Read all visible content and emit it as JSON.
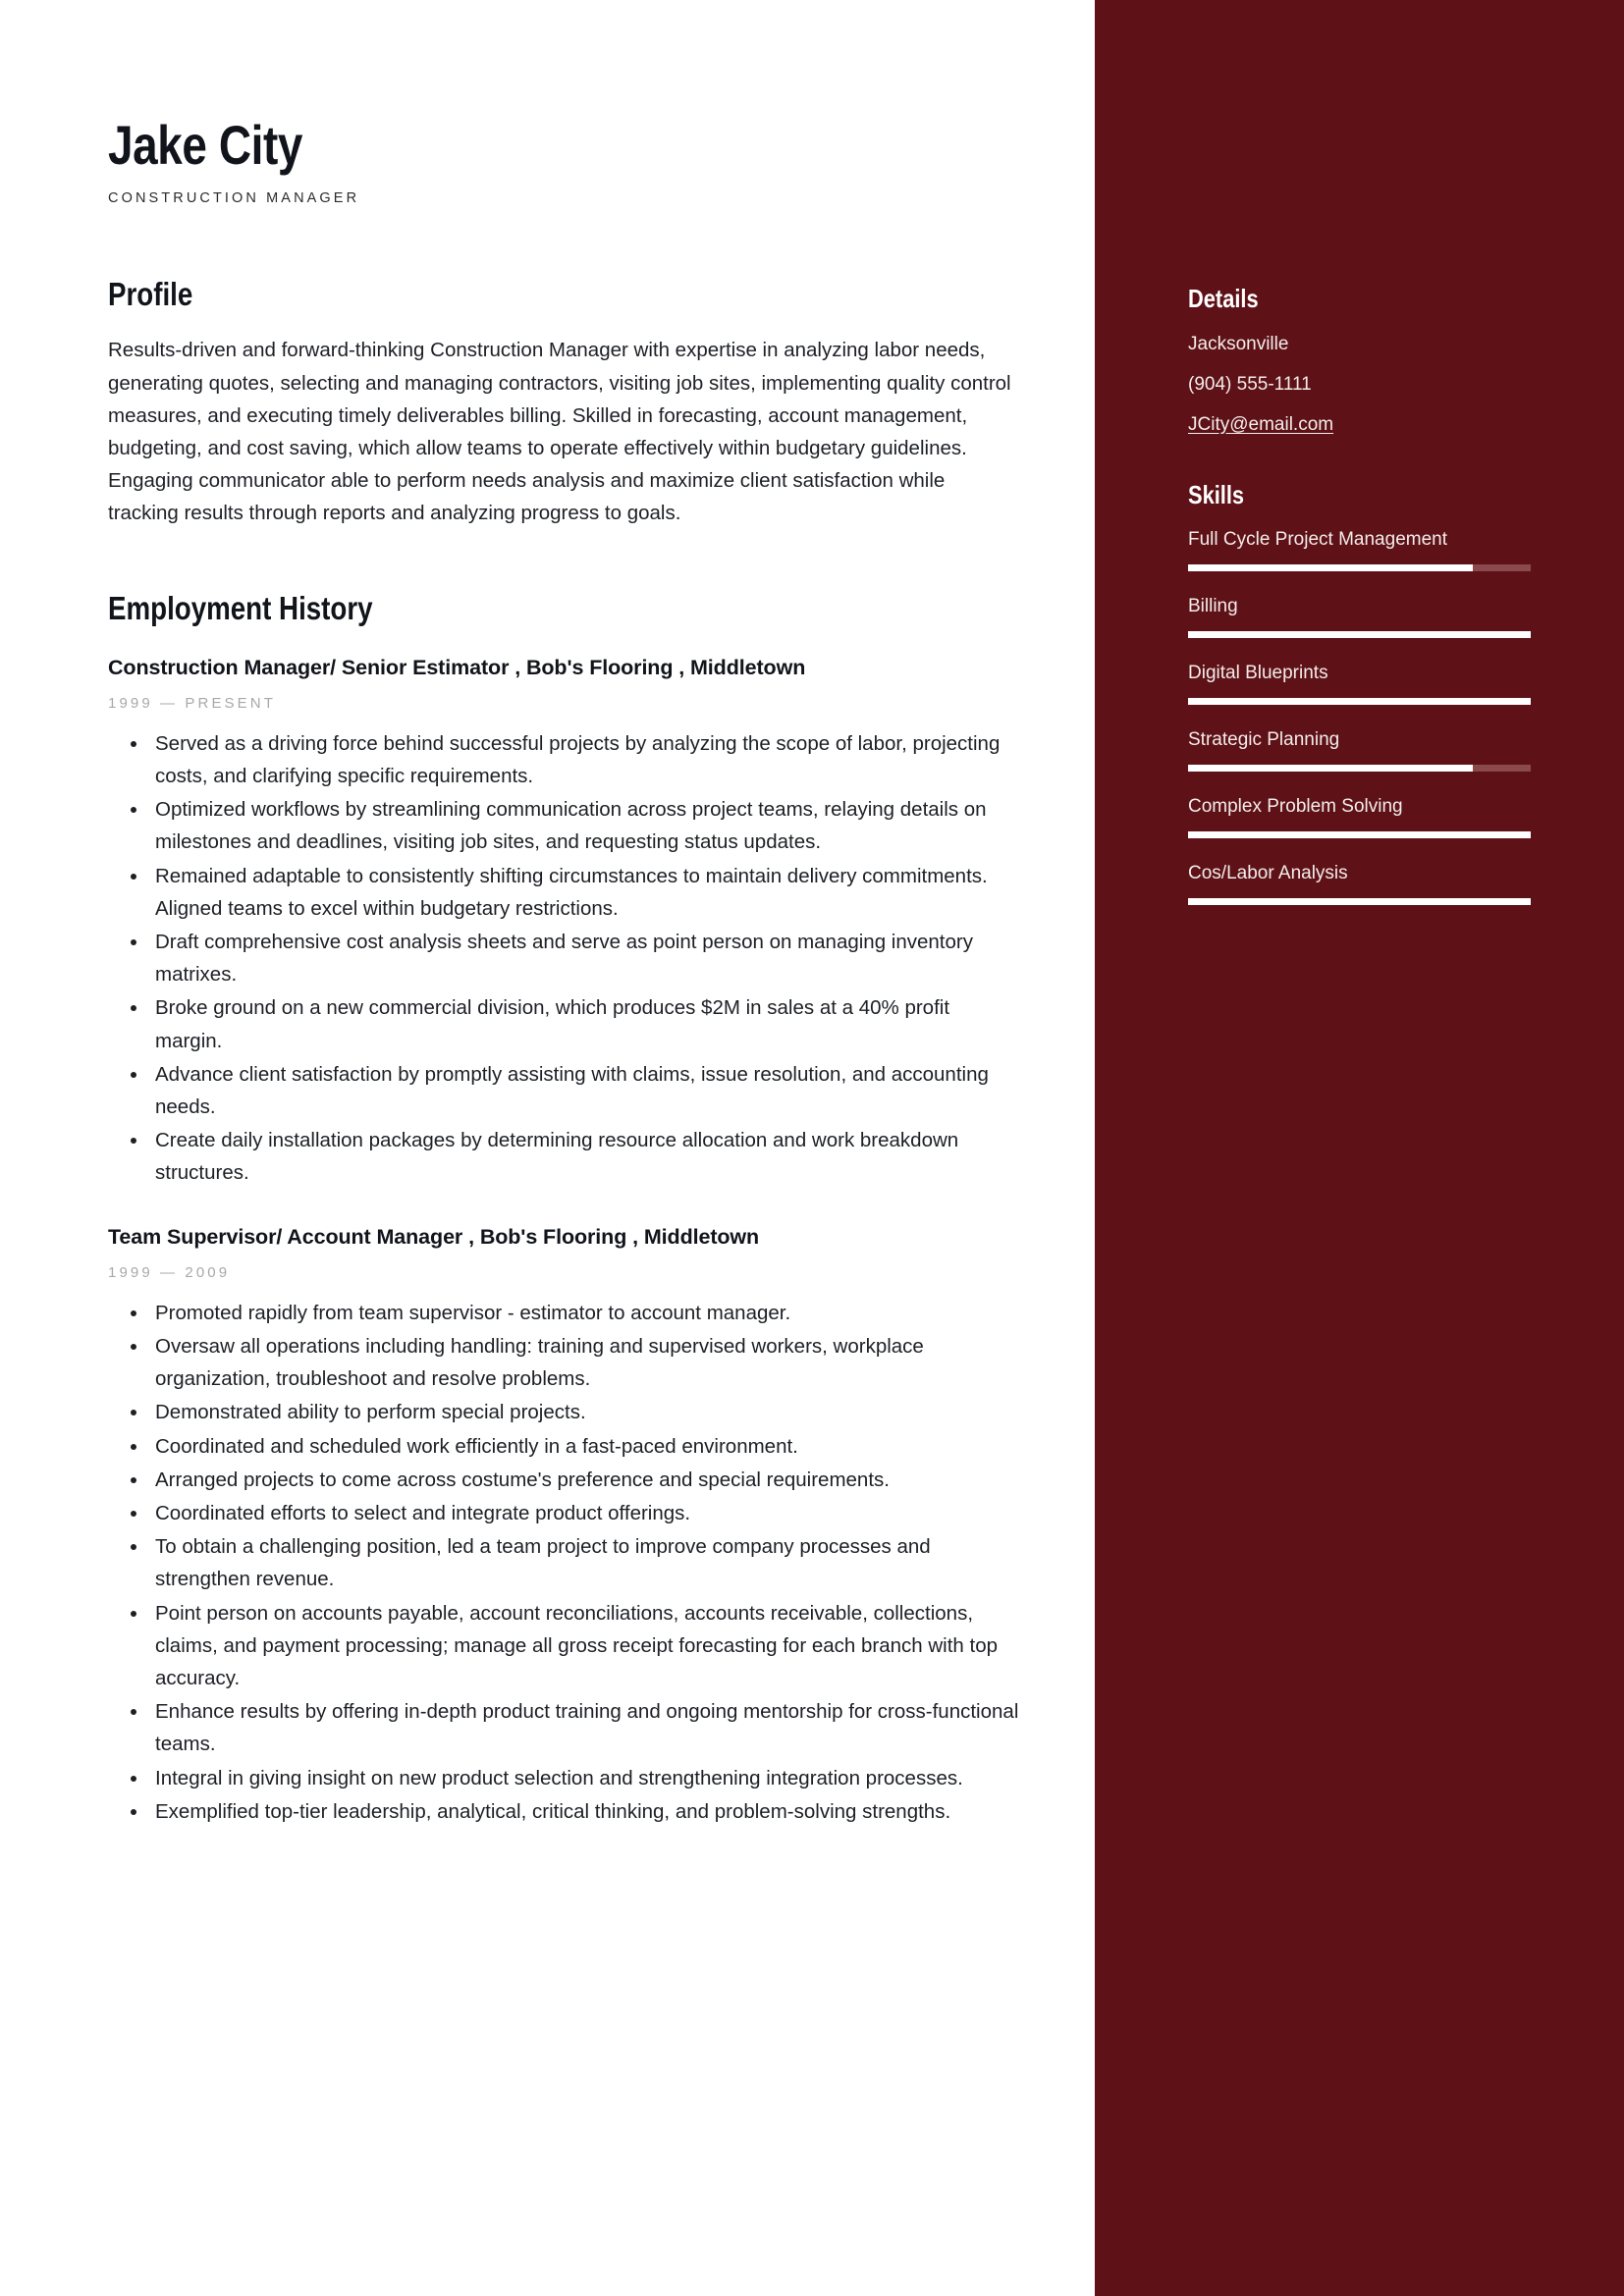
{
  "header": {
    "name": "Jake City",
    "subtitle": "CONSTRUCTION MANAGER"
  },
  "profile": {
    "heading": "Profile",
    "text": "Results-driven and forward-thinking Construction Manager with expertise in analyzing labor needs, generating quotes, selecting and managing contractors, visiting job sites, implementing quality control measures, and executing timely deliverables billing. Skilled in forecasting, account management, budgeting, and cost saving, which allow teams to operate effectively within budgetary guidelines. Engaging communicator able to perform needs analysis and maximize client satisfaction while tracking results through reports and analyzing progress to goals."
  },
  "employment": {
    "heading": "Employment History",
    "jobs": [
      {
        "title": "Construction Manager/ Senior Estimator , Bob's Flooring , Middletown",
        "dates": "1999 — PRESENT",
        "bullets": [
          "Served as a driving force behind successful projects by analyzing the scope of labor, projecting costs, and clarifying specific requirements.",
          "Optimized workflows by streamlining communication across project teams, relaying details on milestones and deadlines, visiting job sites, and requesting status updates.",
          "Remained adaptable to consistently shifting circumstances to maintain delivery commitments. Aligned teams to excel within budgetary restrictions.",
          "Draft comprehensive cost analysis sheets and serve as point person on managing inventory matrixes.",
          "Broke ground on a new commercial division, which produces $2M in sales at a 40% profit margin.",
          "Advance client satisfaction by promptly assisting with claims, issue resolution, and accounting needs.",
          "Create daily installation packages by determining resource allocation and work breakdown structures."
        ]
      },
      {
        "title": "Team Supervisor/ Account Manager , Bob's Flooring , Middletown",
        "dates": "1999 — 2009",
        "bullets": [
          "Promoted rapidly from team supervisor - estimator to account manager.",
          "Oversaw all operations including handling: training and supervised workers, workplace organization, troubleshoot and resolve problems.",
          "Demonstrated ability to perform special projects.",
          "Coordinated and scheduled work efficiently in a fast-paced environment.",
          "Arranged projects to come across costume's preference and special requirements.",
          "Coordinated efforts to select and integrate product offerings.",
          "To obtain a challenging position, led a team project to improve company processes and strengthen revenue.",
          "Point person on accounts payable, account reconciliations, accounts receivable, collections, claims, and payment processing; manage all gross receipt forecasting for each branch with top accuracy.",
          "Enhance results by offering in-depth product training and ongoing mentorship for cross-functional teams.",
          "Integral in giving insight on new product selection and strengthening integration processes.",
          "Exemplified top-tier leadership, analytical, critical thinking, and problem-solving strengths."
        ]
      }
    ]
  },
  "sidebar": {
    "details": {
      "heading": "Details",
      "items": [
        {
          "value": "Jacksonville",
          "type": "text"
        },
        {
          "value": "(904) 555-1111",
          "type": "text"
        },
        {
          "value": "JCity@email.com",
          "type": "link"
        }
      ]
    },
    "skills": {
      "heading": "Skills",
      "items": [
        {
          "label": "Full Cycle Project Management",
          "level": 83
        },
        {
          "label": "Billing",
          "level": 100
        },
        {
          "label": "Digital Blueprints",
          "level": 100
        },
        {
          "label": "Strategic Planning",
          "level": 83
        },
        {
          "label": "Complex Problem Solving",
          "level": 100
        },
        {
          "label": "Cos/Labor Analysis",
          "level": 100
        }
      ]
    }
  },
  "colors": {
    "sidebar_background": "#5e1217",
    "skill_track": "#8a4a4d",
    "skill_fill": "#ffffff",
    "heading_text": "#11141b",
    "body_text": "#1d2025",
    "muted_text": "#a8a8a8"
  }
}
